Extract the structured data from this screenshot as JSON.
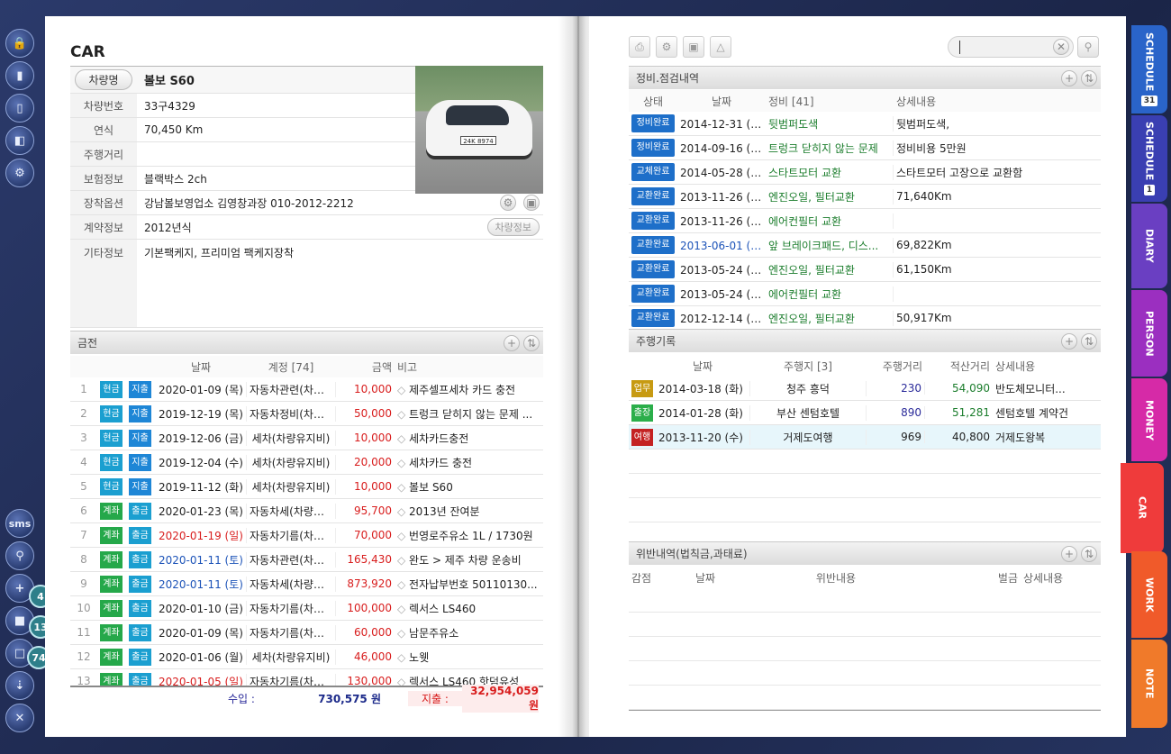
{
  "rail": {
    "sms": "sms",
    "badges": [
      "4",
      "13",
      "74"
    ]
  },
  "left": {
    "title": "CAR",
    "name_label": "차량명",
    "name_value": "볼보 S60",
    "fields": [
      {
        "label": "차량번호",
        "value": "33구4329"
      },
      {
        "label": "연식",
        "value": "70,450 Km"
      },
      {
        "label": "주행거리",
        "value": ""
      },
      {
        "label": "보험정보",
        "value": "블랙박스 2ch"
      },
      {
        "label": "장착옵션",
        "value": "강남볼보영업소 김영창과장 010-2012-2212"
      },
      {
        "label": "계약정보",
        "value": "2012년식"
      },
      {
        "label": "기타정보",
        "value": "기본팩케지, 프리미엄 팩케지장착"
      }
    ],
    "car_info_button": "차량정보",
    "plate": "24K 8974"
  },
  "money": {
    "title": "금전",
    "headers": {
      "date": "날짜",
      "account": "계정 [74]",
      "amount": "금액",
      "note": "비고"
    },
    "rows": [
      {
        "n": "1",
        "t1": "현금",
        "t2": "지출",
        "date": "2020-01-09 (목)",
        "dc": "",
        "acc": "자동차관련(차량...",
        "amt": "10,000",
        "note": "제주셀프세차 카드 충전"
      },
      {
        "n": "2",
        "t1": "현금",
        "t2": "지출",
        "date": "2019-12-19 (목)",
        "dc": "",
        "acc": "자동차정비(차량...",
        "amt": "50,000",
        "note": "트렁크 닫히지 않는 문제 ..."
      },
      {
        "n": "3",
        "t1": "현금",
        "t2": "지출",
        "date": "2019-12-06 (금)",
        "dc": "",
        "acc": "세차(차량유지비)",
        "amt": "10,000",
        "note": "세차카드충전"
      },
      {
        "n": "4",
        "t1": "현금",
        "t2": "지출",
        "date": "2019-12-04 (수)",
        "dc": "",
        "acc": "세차(차량유지비)",
        "amt": "20,000",
        "note": "세차카드 충전"
      },
      {
        "n": "5",
        "t1": "현금",
        "t2": "지출",
        "date": "2019-11-12 (화)",
        "dc": "",
        "acc": "세차(차량유지비)",
        "amt": "10,000",
        "note": "볼보 S60"
      },
      {
        "n": "6",
        "t1": "계좌",
        "t2": "출금",
        "date": "2020-01-23 (목)",
        "dc": "",
        "acc": "자동차세(차량유...",
        "amt": "95,700",
        "note": "2013년 잔여분"
      },
      {
        "n": "7",
        "t1": "계좌",
        "t2": "출금",
        "date": "2020-01-19 (일)",
        "dc": "red",
        "acc": "자동차기름(차량...",
        "amt": "70,000",
        "note": "번영로주유소 1L / 1730원"
      },
      {
        "n": "8",
        "t1": "계좌",
        "t2": "출금",
        "date": "2020-01-11 (토)",
        "dc": "blue",
        "acc": "자동차관련(차량...",
        "amt": "165,430",
        "note": "완도 > 제주 차량 운송비"
      },
      {
        "n": "9",
        "t1": "계좌",
        "t2": "출금",
        "date": "2020-01-11 (토)",
        "dc": "blue",
        "acc": "자동차세(차량유...",
        "amt": "873,920",
        "note": "전자납부번호 50110130..."
      },
      {
        "n": "10",
        "t1": "계좌",
        "t2": "출금",
        "date": "2020-01-10 (금)",
        "dc": "",
        "acc": "자동차기름(차량...",
        "amt": "100,000",
        "note": "렉서스 LS460"
      },
      {
        "n": "11",
        "t1": "계좌",
        "t2": "출금",
        "date": "2020-01-09 (목)",
        "dc": "",
        "acc": "자동차기름(차량...",
        "amt": "60,000",
        "note": "남문주유소"
      },
      {
        "n": "12",
        "t1": "계좌",
        "t2": "출금",
        "date": "2020-01-06 (월)",
        "dc": "",
        "acc": "세차(차량유지비)",
        "amt": "46,000",
        "note": "노웻"
      },
      {
        "n": "13",
        "t1": "계좌",
        "t2": "출금",
        "date": "2020-01-05 (일)",
        "dc": "red",
        "acc": "자동차기름(차량...",
        "amt": "130,000",
        "note": "렉서스 LS460 핫덤유성"
      }
    ],
    "income_label": "수입 :",
    "income": "730,575 원",
    "expense_label": "지출 :",
    "expense": "32,954,059 원"
  },
  "maint": {
    "title": "정비.점검내역",
    "headers": {
      "status": "상태",
      "date": "날짜",
      "item": "정비 [41]",
      "detail": "상세내용"
    },
    "rows": [
      {
        "s": "정비완료",
        "date": "2014-12-31 (수)",
        "dc": "",
        "item": "뒷범퍼도색",
        "detail": "뒷범퍼도색,"
      },
      {
        "s": "정비완료",
        "date": "2014-09-16 (화)",
        "dc": "",
        "item": "트렁크 닫히지 않는 문제",
        "detail": "정비비용 5만원"
      },
      {
        "s": "교체완료",
        "date": "2014-05-28 (수)",
        "dc": "",
        "item": "스타트모터 교환",
        "detail": "스타트모터 고장으로 교환함"
      },
      {
        "s": "교환완료",
        "date": "2013-11-26 (화)",
        "dc": "",
        "item": "엔진오일, 필터교환",
        "detail": "71,640Km"
      },
      {
        "s": "교환완료",
        "date": "2013-11-26 (화)",
        "dc": "",
        "item": "에어컨필터 교환",
        "detail": ""
      },
      {
        "s": "교환완료",
        "date": "2013-06-01 (토)",
        "dc": "blue",
        "item": "앞 브레이크패드, 디스...",
        "detail": "69,822Km"
      },
      {
        "s": "교환완료",
        "date": "2013-05-24 (금)",
        "dc": "",
        "item": "엔진오일, 필터교환",
        "detail": "61,150Km"
      },
      {
        "s": "교환완료",
        "date": "2013-05-24 (금)",
        "dc": "",
        "item": "에어컨필터 교환",
        "detail": ""
      },
      {
        "s": "교환완료",
        "date": "2012-12-14 (금)",
        "dc": "",
        "item": "엔진오일, 필터교환",
        "detail": "50,917Km"
      }
    ]
  },
  "drive": {
    "title": "주행기록",
    "headers": {
      "date": "날짜",
      "place": "주행지 [3]",
      "dist": "주행거리",
      "total": "적산거리",
      "detail": "상세내용"
    },
    "rows": [
      {
        "tag": "업무",
        "tc": "#c79a12",
        "date": "2014-03-18 (화)",
        "place": "청주 흥덕",
        "dist": "230",
        "total": "54,090",
        "detail": "반도체모니터..."
      },
      {
        "tag": "출장",
        "tc": "#2bae4a",
        "date": "2014-01-28 (화)",
        "place": "부산 센텀호텔",
        "dist": "890",
        "total": "51,281",
        "detail": "센텀호텔 계약건"
      },
      {
        "tag": "여행",
        "tc": "#c42222",
        "date": "2013-11-20 (수)",
        "place": "거제도여행",
        "dist": "969",
        "total": "40,800",
        "detail": "거제도왕복"
      }
    ]
  },
  "violation": {
    "title": "위반내역(법칙금,과태료)",
    "headers": {
      "points": "감점",
      "date": "날짜",
      "content": "위반내용",
      "fine": "벌금",
      "detail": "상세내용"
    }
  },
  "tabs": [
    {
      "label": "SCHEDULE",
      "color": "#2a64c9",
      "extra": "31"
    },
    {
      "label": "SCHEDULE",
      "color": "#3a3fb2",
      "extra": "1"
    },
    {
      "label": "DIARY",
      "color": "#6a3fc2",
      "extra": ""
    },
    {
      "label": "PERSON",
      "color": "#9b2fc0",
      "extra": ""
    },
    {
      "label": "MONEY",
      "color": "#d62aa7",
      "extra": ""
    },
    {
      "label": "CAR",
      "color": "#ef3b3b",
      "extra": ""
    },
    {
      "label": "WORK",
      "color": "#f05a2a",
      "extra": ""
    },
    {
      "label": "NOTE",
      "color": "#f07a2a",
      "extra": ""
    }
  ]
}
